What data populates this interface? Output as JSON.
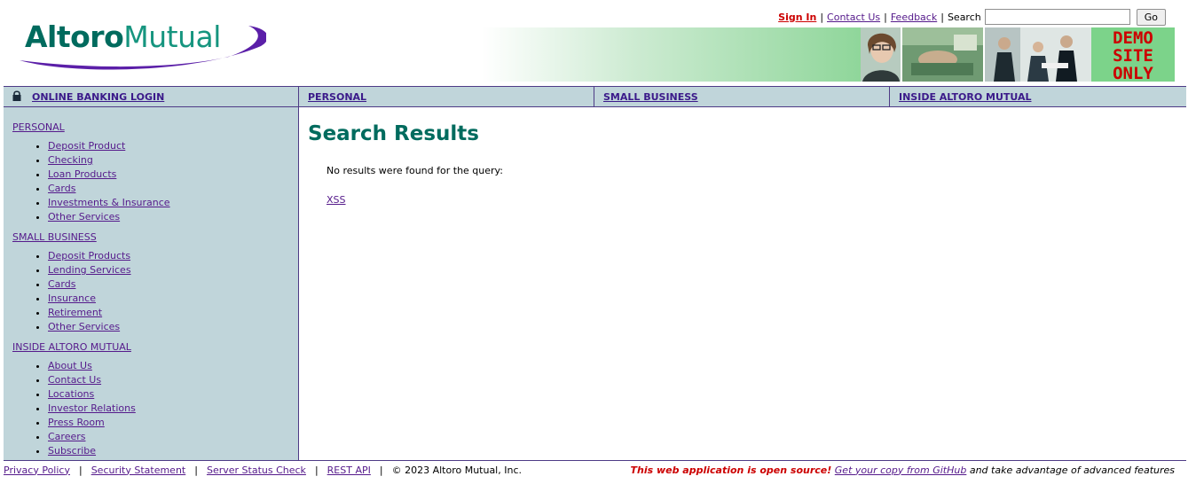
{
  "brand": {
    "part1": "Altoro",
    "part2": "Mutual"
  },
  "toplinks": {
    "sign_in": "Sign In",
    "contact_us": "Contact Us",
    "feedback": "Feedback",
    "search_label": "Search",
    "search_value": "",
    "go_button": "Go"
  },
  "banner": {
    "demo_line1": "DEMO",
    "demo_line2": "SITE",
    "demo_line3": "ONLY"
  },
  "nav": {
    "login": "ONLINE BANKING LOGIN",
    "personal": "PERSONAL",
    "small_business": "SMALL BUSINESS",
    "inside": "INSIDE ALTORO MUTUAL"
  },
  "sidebar": {
    "personal": {
      "title": "PERSONAL",
      "items": [
        "Deposit Product",
        "Checking",
        "Loan Products",
        "Cards",
        "Investments & Insurance",
        "Other Services"
      ]
    },
    "small_business": {
      "title": "SMALL BUSINESS",
      "items": [
        "Deposit Products",
        "Lending Services",
        "Cards",
        "Insurance",
        "Retirement",
        "Other Services"
      ]
    },
    "inside": {
      "title": "INSIDE ALTORO MUTUAL",
      "items": [
        "About Us",
        "Contact Us",
        "Locations",
        "Investor Relations",
        "Press Room",
        "Careers",
        "Subscribe"
      ]
    }
  },
  "main": {
    "title": "Search Results",
    "message": "No results were found for the query:",
    "query": "XSS"
  },
  "footer": {
    "privacy": "Privacy Policy",
    "security": "Security Statement",
    "server_status": "Server Status Check",
    "rest_api": "REST API",
    "copyright": "© 2023 Altoro Mutual, Inc.",
    "open_source": "This web application is open source!",
    "github_link": "Get your copy from GitHub",
    "tail": "and take advantage of advanced features"
  },
  "colors": {
    "brand_teal": "#006b5e",
    "nav_background": "#c0d5da",
    "border_purple": "#4e3b86",
    "alert_red": "#cc0000"
  }
}
